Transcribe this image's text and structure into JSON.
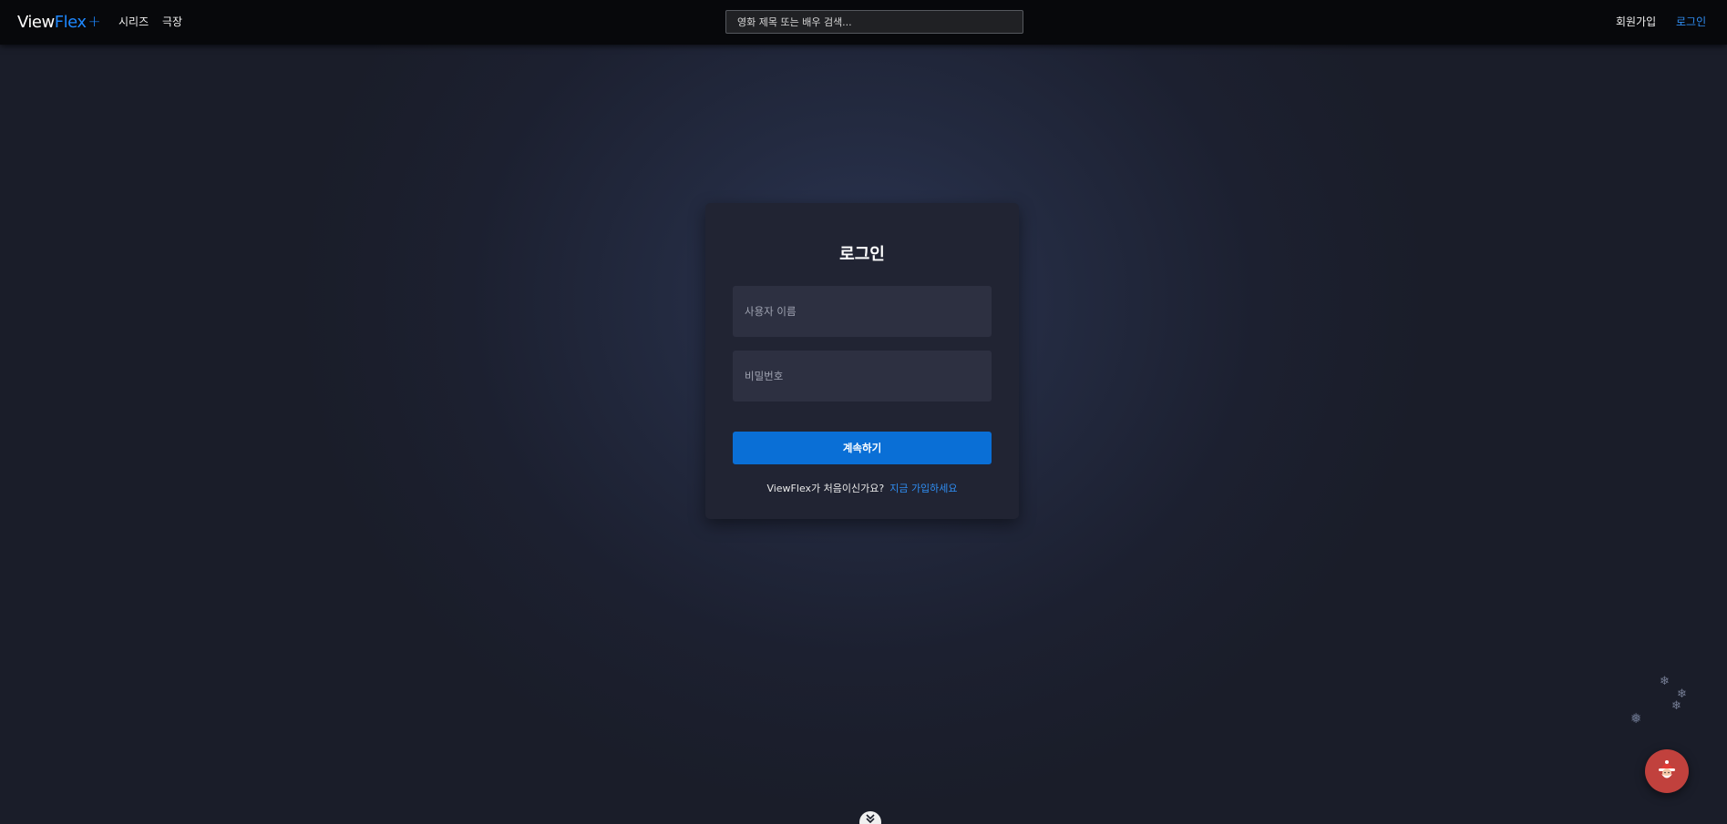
{
  "header": {
    "logo_main": "View",
    "logo_accent": "Flex",
    "logo_plus": "+",
    "nav": [
      "시리즈",
      "극장"
    ],
    "search_placeholder": "영화 제목 또는 배우 검색...",
    "signup_label": "회원가입",
    "login_label": "로그인"
  },
  "login_card": {
    "title": "로그인",
    "username_placeholder": "사용자 이름",
    "password_placeholder": "비밀번호",
    "continue_label": "계속하기",
    "new_user_prompt": "ViewFlex가 처음이신가요?",
    "signup_link": "지금 가입하세요"
  },
  "icons": {
    "fab": "santa-icon",
    "scroll": "chevron-down-icon",
    "decor": "snowflake-icon"
  },
  "colors": {
    "accent": "#0a6fd6",
    "link": "#2f8cf0",
    "fab": "#c1413d"
  }
}
